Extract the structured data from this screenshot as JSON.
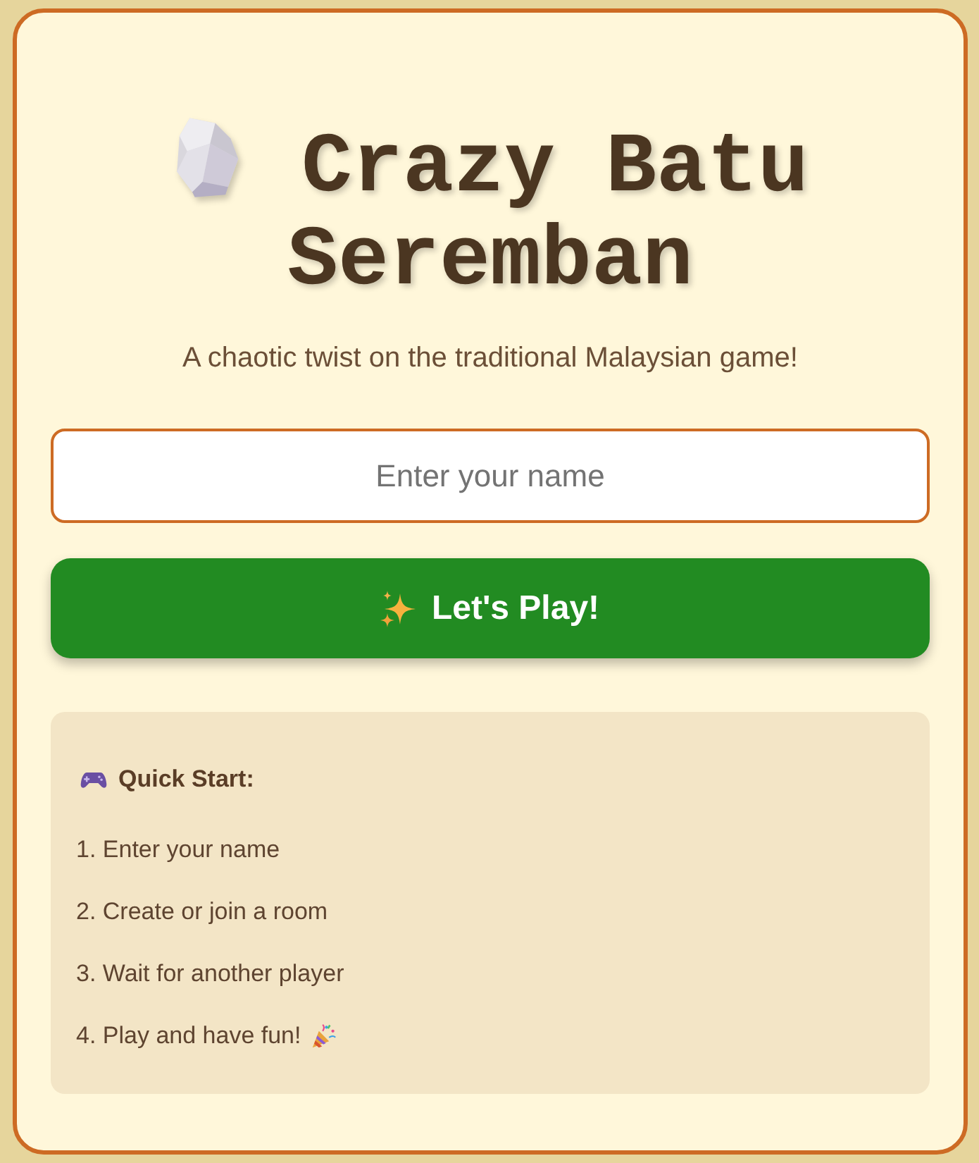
{
  "title": "Crazy Batu Seremban",
  "subtitle": "A chaotic twist on the traditional Malaysian game!",
  "name_field": {
    "placeholder": "Enter your name"
  },
  "play_button": {
    "label": "Let's Play!"
  },
  "quick_start": {
    "heading": "Quick Start:",
    "steps": [
      "1. Enter your name",
      "2. Create or join a room",
      "3. Wait for another player",
      "4. Play and have fun!"
    ]
  }
}
